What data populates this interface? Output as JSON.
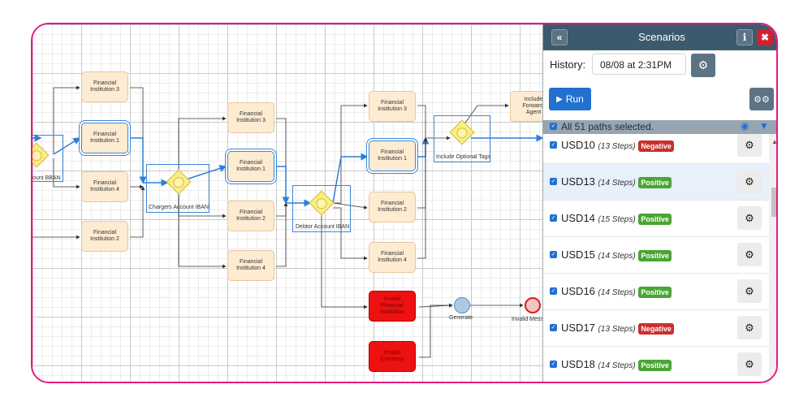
{
  "diagram": {
    "tasks": [
      {
        "id": "t1",
        "lines": [
          "Financial",
          "Institution 3"
        ],
        "state": "normal"
      },
      {
        "id": "t2",
        "lines": [
          "Financial",
          "Institution 1"
        ],
        "state": "selected"
      },
      {
        "id": "t3",
        "lines": [
          "Financial",
          "Institution 4"
        ],
        "state": "normal"
      },
      {
        "id": "t4",
        "lines": [
          "Financial",
          "Institution 2"
        ],
        "state": "normal"
      },
      {
        "id": "t5",
        "lines": [
          "Financial",
          "Institution 3"
        ],
        "state": "normal"
      },
      {
        "id": "t6",
        "lines": [
          "Financial",
          "Institution 1"
        ],
        "state": "selected"
      },
      {
        "id": "t7",
        "lines": [
          "Financial",
          "Institution 2"
        ],
        "state": "normal"
      },
      {
        "id": "t8",
        "lines": [
          "Financial",
          "Institution 4"
        ],
        "state": "normal"
      },
      {
        "id": "t9",
        "lines": [
          "Financial",
          "Institution 3"
        ],
        "state": "normal"
      },
      {
        "id": "t10",
        "lines": [
          "Financial",
          "Institution 1"
        ],
        "state": "selected"
      },
      {
        "id": "t11",
        "lines": [
          "Financial",
          "Institution 2"
        ],
        "state": "normal"
      },
      {
        "id": "t12",
        "lines": [
          "Financial",
          "Institution 4"
        ],
        "state": "normal"
      },
      {
        "id": "t13",
        "lines": [
          "Invalid",
          "Financial",
          "Institution"
        ],
        "state": "error"
      },
      {
        "id": "t14",
        "lines": [
          "Invalid",
          "Currency"
        ],
        "state": "error"
      },
      {
        "id": "t15",
        "lines": [
          "Include",
          "Forwardi",
          "Agent"
        ],
        "state": "normal"
      }
    ],
    "gateways": [
      {
        "id": "g1",
        "label": "ount BBAN"
      },
      {
        "id": "g2",
        "label": "Chargers Account IBAN"
      },
      {
        "id": "g3",
        "label": "Debtor Account IBAN"
      },
      {
        "id": "g4",
        "label": "Include Optional Tags"
      }
    ],
    "events": [
      {
        "id": "e1",
        "label": "Generate"
      },
      {
        "id": "e2",
        "label": "Invalid Mess"
      }
    ]
  },
  "panel": {
    "title": "Scenarios",
    "collapse_icon": "«",
    "info_icon": "i",
    "close_icon": "✖",
    "history_label": "History:",
    "history_value": "08/08 at 2:31PM",
    "run_label": "Run",
    "select_all_text": "All 51 paths selected.",
    "scenarios": [
      {
        "name": "USD10",
        "steps": "(13 Steps)",
        "status": "Negative"
      },
      {
        "name": "USD13",
        "steps": "(14 Steps)",
        "status": "Positive"
      },
      {
        "name": "USD14",
        "steps": "(15 Steps)",
        "status": "Positive"
      },
      {
        "name": "USD15",
        "steps": "(14 Steps)",
        "status": "Positive"
      },
      {
        "name": "USD16",
        "steps": "(14 Steps)",
        "status": "Positive"
      },
      {
        "name": "USD17",
        "steps": "(13 Steps)",
        "status": "Negative"
      },
      {
        "name": "USD18",
        "steps": "(14 Steps)",
        "status": "Positive"
      }
    ]
  },
  "colors": {
    "frame_border": "#e8177e",
    "header_bg": "#3c5a6e",
    "run_button": "#2270d0",
    "positive": "#4aa534",
    "negative": "#c9302c",
    "error_task": "#ee1111"
  },
  "icons": {
    "gear": "gear-icon",
    "cogs": "cogs-icon",
    "eye": "eye-icon",
    "filter": "filter-icon",
    "play": "play-icon"
  }
}
